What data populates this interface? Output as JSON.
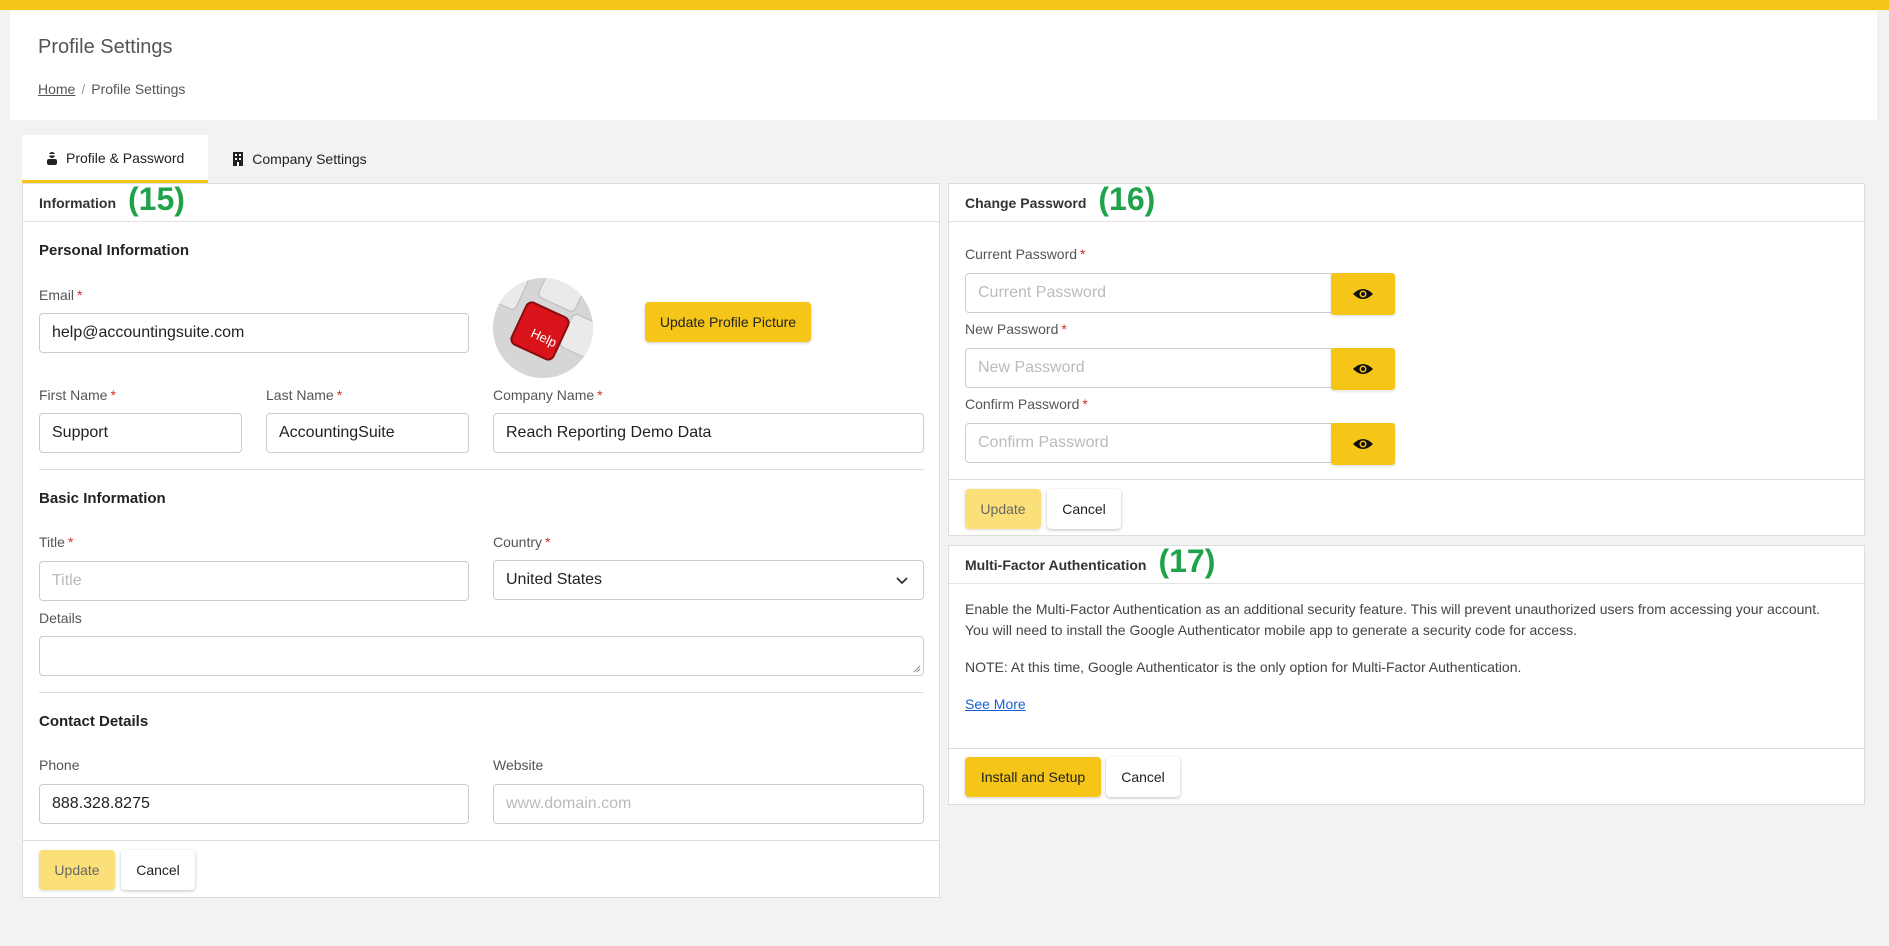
{
  "header": {
    "title": "Profile Settings",
    "breadcrumb": {
      "home": "Home",
      "separator": "/",
      "current": "Profile Settings"
    }
  },
  "tabs": [
    {
      "label": "Profile & Password",
      "icon": "user-secret-icon",
      "active": true
    },
    {
      "label": "Company Settings",
      "icon": "building-icon",
      "active": false
    }
  ],
  "colors": {
    "accent": "#f5c518",
    "marker": "#1fa34a",
    "required": "#d32f2f",
    "link": "#1a5fd0"
  },
  "info_card": {
    "title": "Information",
    "marker": "(15)",
    "personal": {
      "heading": "Personal Information",
      "email_label": "Email",
      "email_value": "help@accountingsuite.com",
      "update_picture_label": "Update Profile Picture",
      "avatar_text": "Help",
      "first_name_label": "First Name",
      "first_name_value": "Support",
      "last_name_label": "Last Name",
      "last_name_value": "AccountingSuite",
      "company_name_label": "Company Name",
      "company_name_value": "Reach Reporting Demo Data"
    },
    "basic": {
      "heading": "Basic Information",
      "title_label": "Title",
      "title_placeholder": "Title",
      "country_label": "Country",
      "country_value": "United States",
      "details_label": "Details"
    },
    "contact": {
      "heading": "Contact Details",
      "phone_label": "Phone",
      "phone_value": "888.328.8275",
      "website_label": "Website",
      "website_placeholder": "www.domain.com"
    },
    "update_label": "Update",
    "cancel_label": "Cancel"
  },
  "password_card": {
    "title": "Change Password",
    "marker": "(16)",
    "current_label": "Current Password",
    "current_placeholder": "Current Password",
    "new_label": "New Password",
    "new_placeholder": "New Password",
    "confirm_label": "Confirm Password",
    "confirm_placeholder": "Confirm Password",
    "update_label": "Update",
    "cancel_label": "Cancel"
  },
  "mfa_card": {
    "title": "Multi-Factor Authentication",
    "marker": "(17)",
    "line1": "Enable the Multi-Factor Authentication as an additional security feature. This will prevent unauthorized users from accessing your account.",
    "line2": "You will need to install the Google Authenticator mobile app to generate a security code for access.",
    "note": "NOTE: At this time, Google Authenticator is the only option for Multi-Factor Authentication.",
    "see_more": "See More",
    "install_label": "Install and Setup",
    "cancel_label": "Cancel"
  }
}
